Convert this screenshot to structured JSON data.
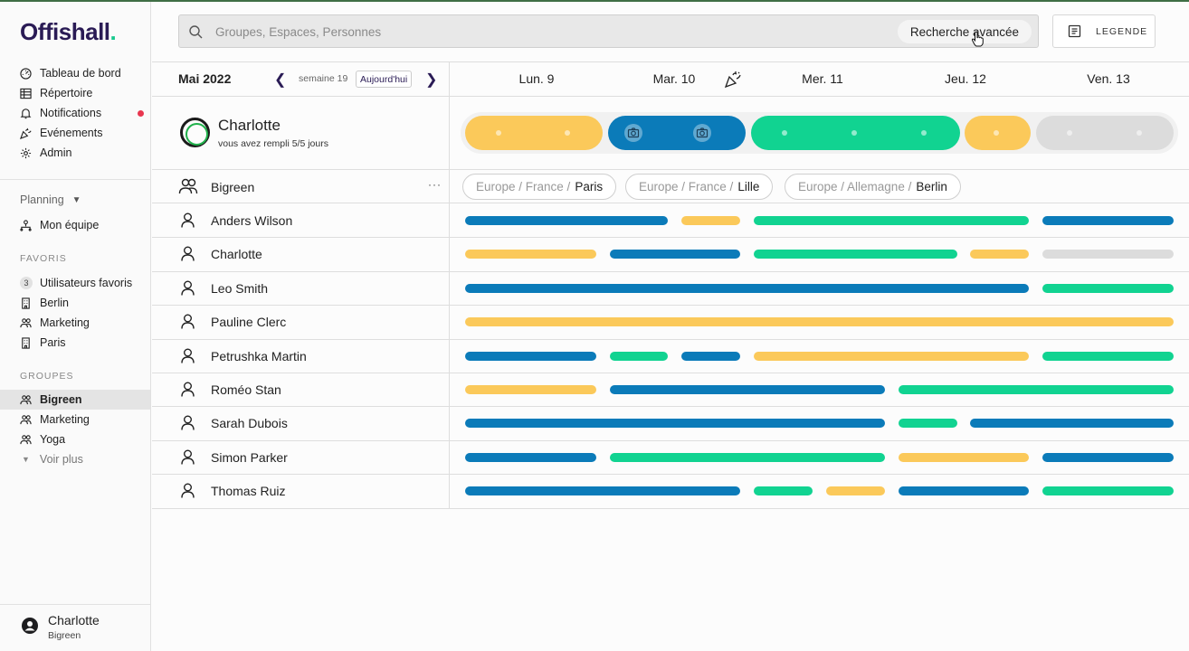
{
  "app": {
    "logo": "Offishall",
    "logo_dot": "."
  },
  "colors": {
    "yellow": "#fbc95a",
    "blue": "#0b7bb9",
    "green": "#11d391",
    "grey": "#dcdcdc",
    "brand": "#2a1b55"
  },
  "sidebar": {
    "nav": [
      {
        "label": "Tableau de bord",
        "icon": "dashboard-icon"
      },
      {
        "label": "Répertoire",
        "icon": "directory-icon"
      },
      {
        "label": "Notifications",
        "icon": "bell-icon",
        "unread": true
      },
      {
        "label": "Evénements",
        "icon": "party-icon"
      },
      {
        "label": "Admin",
        "icon": "gear-icon"
      }
    ],
    "planning_label": "Planning",
    "mon_equipe": "Mon équipe",
    "favoris_label": "FAVORIS",
    "favoris": [
      {
        "label": "Utilisateurs favoris",
        "icon": "count-badge",
        "count": "3"
      },
      {
        "label": "Berlin",
        "icon": "building-icon"
      },
      {
        "label": "Marketing",
        "icon": "group-icon"
      },
      {
        "label": "Paris",
        "icon": "building-icon"
      }
    ],
    "groupes_label": "GROUPES",
    "groupes": [
      {
        "label": "Bigreen",
        "active": true
      },
      {
        "label": "Marketing",
        "active": false
      },
      {
        "label": "Yoga",
        "active": false
      }
    ],
    "voir_plus": "Voir plus",
    "user": {
      "name": "Charlotte",
      "org": "Bigreen"
    }
  },
  "search": {
    "placeholder": "Groupes, Espaces, Personnes",
    "value": "",
    "advanced": "Recherche avancée"
  },
  "legend_button": "LEGENDE",
  "calendar": {
    "month": "Mai 2022",
    "week": "semaine 19",
    "today": "Aujourd'hui",
    "days": [
      "Lun. 9",
      "Mar. 10",
      "Mer. 11",
      "Jeu. 12",
      "Ven. 13"
    ],
    "me": {
      "name": "Charlotte",
      "subtitle": "vous avez rempli 5/5 jours"
    },
    "team": {
      "name": "Bigreen",
      "locations": [
        {
          "path": "Europe / France /",
          "city": "Paris"
        },
        {
          "path": "Europe / France /",
          "city": "Lille"
        },
        {
          "path": "Europe / Allemagne /",
          "city": "Berlin"
        }
      ]
    },
    "people": [
      "Anders Wilson",
      "Charlotte",
      "Leo Smith",
      "Pauline Clerc",
      "Petrushka Martin",
      "Roméo Stan",
      "Sarah Dubois",
      "Simon Parker",
      "Thomas Ruiz"
    ]
  }
}
